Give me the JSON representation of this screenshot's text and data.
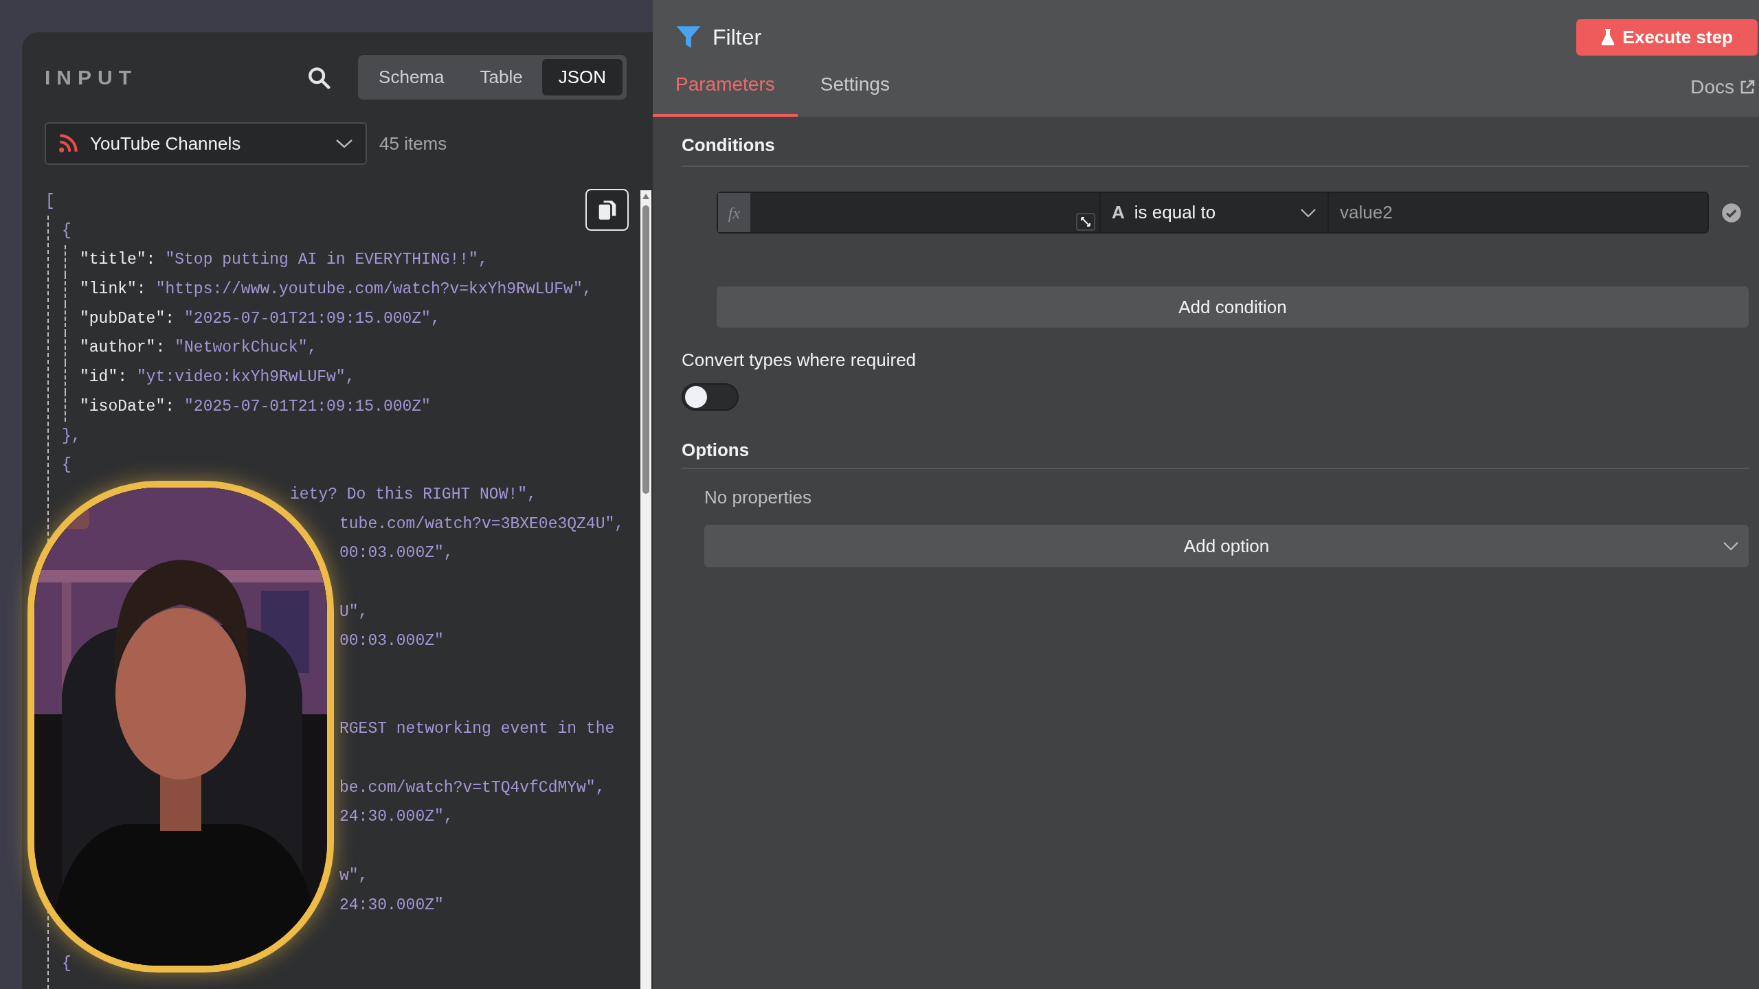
{
  "input_panel": {
    "title": "INPUT",
    "view_tabs": [
      {
        "label": "Schema",
        "selected": false
      },
      {
        "label": "Table",
        "selected": false
      },
      {
        "label": "JSON",
        "selected": true
      }
    ],
    "source": {
      "label": "YouTube Channels"
    },
    "item_count": "45 items",
    "code_lines": [
      {
        "kind": "root_open",
        "text": "["
      },
      {
        "kind": "item_open",
        "text": "{"
      },
      {
        "kind": "entry",
        "key": "\"title\":",
        "value": "\"Stop putting AI in EVERYTHING!!\","
      },
      {
        "kind": "entry",
        "key": "\"link\":",
        "value": "\"https://www.youtube.com/watch?v=kxYh9RwLUFw\","
      },
      {
        "kind": "entry",
        "key": "\"pubDate\":",
        "value": "\"2025-07-01T21:09:15.000Z\","
      },
      {
        "kind": "entry",
        "key": "\"author\":",
        "value": "\"NetworkChuck\","
      },
      {
        "kind": "entry",
        "key": "\"id\":",
        "value": "\"yt:video:kxYh9RwLUFw\","
      },
      {
        "kind": "entry",
        "key": "\"isoDate\":",
        "value": "\"2025-07-01T21:09:15.000Z\""
      },
      {
        "kind": "item_close",
        "text": "},"
      },
      {
        "kind": "item_open",
        "text": "{"
      },
      {
        "kind": "partial_top",
        "text": "iety? Do this RIGHT NOW!\","
      },
      {
        "kind": "partial",
        "text": "tube.com/watch?v=3BXE0e3QZ4U\","
      },
      {
        "kind": "partial",
        "text": "00:03.000Z\","
      },
      {
        "kind": "blank"
      },
      {
        "kind": "partial",
        "text": "U\","
      },
      {
        "kind": "partial",
        "text": "00:03.000Z\""
      },
      {
        "kind": "blank"
      },
      {
        "kind": "blank"
      },
      {
        "kind": "partial",
        "text": "RGEST networking event in the"
      },
      {
        "kind": "blank"
      },
      {
        "kind": "partial",
        "text": "be.com/watch?v=tTQ4vfCdMYw\","
      },
      {
        "kind": "partial",
        "text": "24:30.000Z\","
      },
      {
        "kind": "blank"
      },
      {
        "kind": "partial",
        "text": "w\","
      },
      {
        "kind": "partial",
        "text": "24:30.000Z\""
      },
      {
        "kind": "blank"
      },
      {
        "kind": "item_open",
        "text": "{"
      }
    ]
  },
  "node_panel": {
    "title": "Filter",
    "execute_button": "Execute step",
    "tabs": [
      {
        "label": "Parameters",
        "selected": true
      },
      {
        "label": "Settings",
        "selected": false
      }
    ],
    "docs_link": "Docs",
    "conditions": {
      "label": "Conditions",
      "rows": [
        {
          "expression_marker": "fx",
          "type_glyph": "A",
          "operator": "is equal to",
          "right_placeholder": "value2"
        }
      ],
      "add_button": "Add condition"
    },
    "convert_types": {
      "label": "Convert types where required",
      "on": false
    },
    "options": {
      "label": "Options",
      "empty_text": "No properties",
      "add_button": "Add option"
    }
  }
}
